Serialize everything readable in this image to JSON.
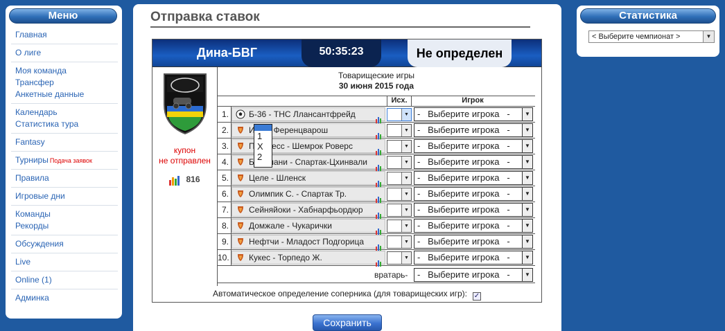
{
  "menu": {
    "title": "Меню",
    "items": [
      {
        "label": "Главная"
      },
      {
        "label": "О лиге"
      },
      {
        "lines": [
          "Моя команда",
          "Трансфер",
          "Анкетные данные"
        ]
      },
      {
        "lines": [
          "Календарь",
          "Статистика тура"
        ]
      },
      {
        "label": "Fantasy"
      },
      {
        "label": "Турниры",
        "note": "Подача заявок"
      },
      {
        "label": "Правила"
      },
      {
        "label": "Игровые дни"
      },
      {
        "lines": [
          "Команды",
          "Рекорды"
        ]
      },
      {
        "label": "Обсуждения"
      },
      {
        "label": "Live"
      },
      {
        "label": "Online (1)"
      },
      {
        "label": "Админка"
      }
    ]
  },
  "stats": {
    "title": "Статистика",
    "select_value": "< Выберите чемпионат >"
  },
  "main": {
    "title": "Отправка ставок",
    "team": "Дина-БВГ",
    "timer": "50:35:23",
    "status": "Не определен",
    "games_type": "Товарищеские игры",
    "date": "30 июня 2015 года",
    "coupon_line1": "купон",
    "coupon_line2": "не отправлен",
    "rating": "816",
    "col_outcome": "Исх.",
    "col_player": "Игрок",
    "player_placeholder": "-   Выберите игрока   -",
    "goalkeeper_label": "вратарь-",
    "auto_label": "Автоматическое определение соперника (для товарищеских игр):",
    "auto_checked": true,
    "save_label": "Сохранить",
    "outcome_options": [
      "1",
      "X",
      "2"
    ],
    "matches": [
      {
        "num": "1.",
        "name": "Б-36 - ТНС Лланcантфрейд",
        "icon": "soccer-ball-icon"
      },
      {
        "num": "2.",
        "name": "Игяз - Ференцварош",
        "icon": "europa-league-icon"
      },
      {
        "num": "3.",
        "name": "Прогресс - Шемрок Роверс",
        "icon": "europa-league-icon"
      },
      {
        "num": "4.",
        "name": "Ботошани - Спартак-Цхинвали",
        "icon": "europa-league-icon"
      },
      {
        "num": "5.",
        "name": "Целе - Шленск",
        "icon": "europa-league-icon"
      },
      {
        "num": "6.",
        "name": "Олимпик С. - Спартак Тр.",
        "icon": "europa-league-icon"
      },
      {
        "num": "7.",
        "name": "Сейняйоки - Хабнарфьордюр",
        "icon": "europa-league-icon"
      },
      {
        "num": "8.",
        "name": "Домжале - Чукарички",
        "icon": "europa-league-icon"
      },
      {
        "num": "9.",
        "name": "Нефтчи - Младост Подгорица",
        "icon": "europa-league-icon"
      },
      {
        "num": "10.",
        "name": "Кукес - Торпедо Ж.",
        "icon": "europa-league-icon"
      }
    ]
  }
}
